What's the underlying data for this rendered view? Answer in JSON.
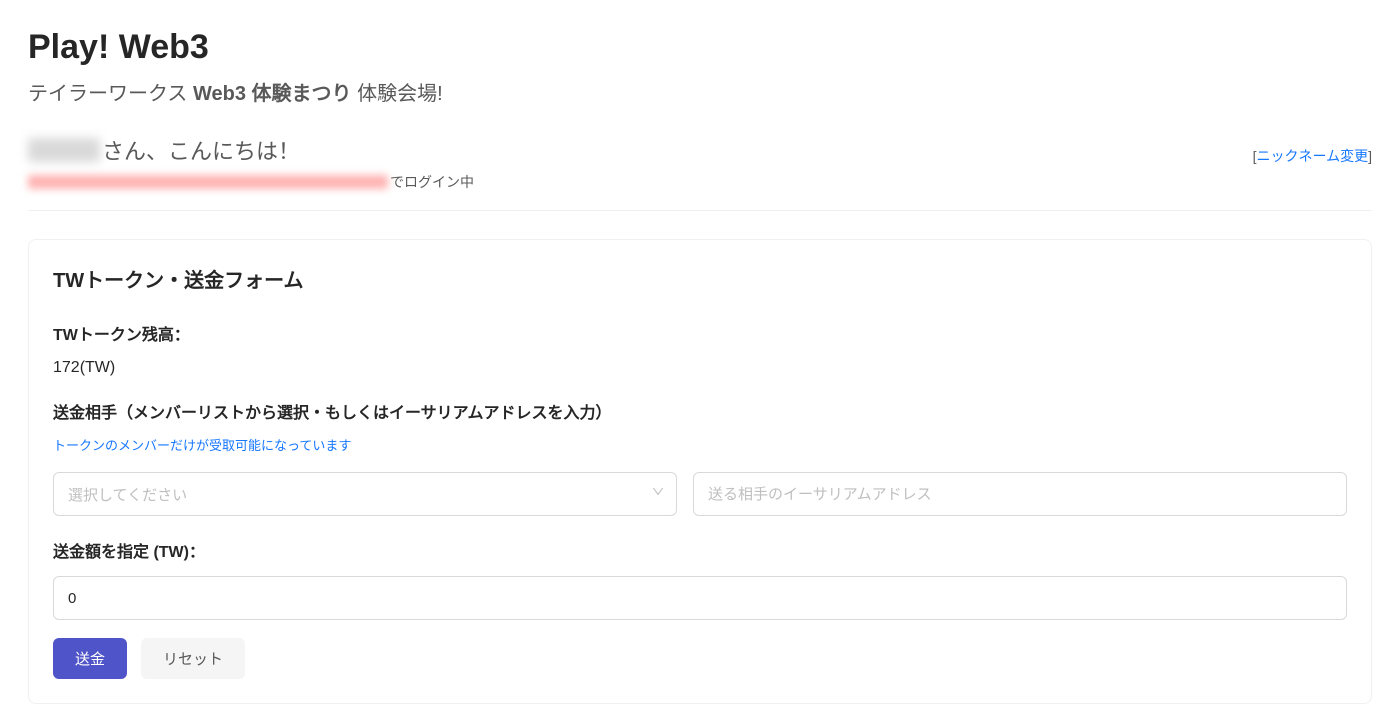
{
  "header": {
    "title": "Play! Web3",
    "subtitle_prefix": "テイラーワークス ",
    "subtitle_bold": "Web3 体験まつり",
    "subtitle_suffix": " 体験会場!",
    "greeting_suffix": "さん、こんにちは！",
    "login_suffix": "でログイン中",
    "nickname_change_label": "ニックネーム変更"
  },
  "form": {
    "title": "TWトークン・送金フォーム",
    "balance_label": "TWトークン残高：",
    "balance_value": "172(TW)",
    "recipient_label": "送金相手（メンバーリストから選択・もしくはイーサリアムアドレスを入力）",
    "note": "トークンのメンバーだけが受取可能になっています",
    "select_placeholder": "選択してください",
    "address_placeholder": "送る相手のイーサリアムアドレス",
    "amount_label": "送金額を指定 (TW)：",
    "amount_value": "0",
    "submit_label": "送金",
    "reset_label": "リセット"
  }
}
